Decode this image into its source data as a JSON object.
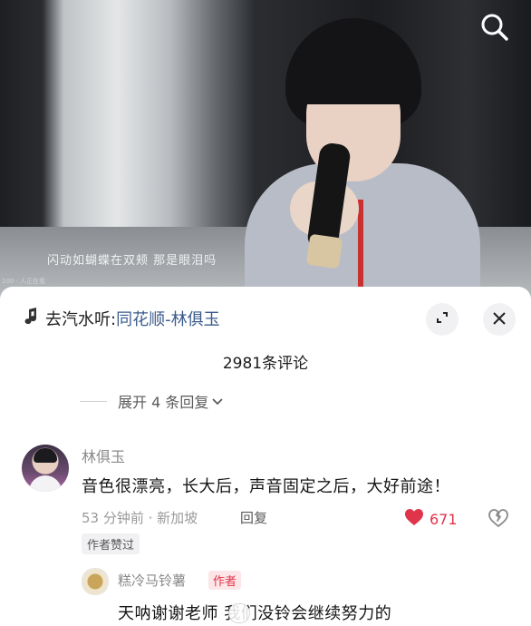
{
  "video": {
    "lyric": "闪动如蝴蝶在双颊 那是眼泪吗",
    "small_watermark": "100 · 人正在看",
    "search_icon": "search-icon"
  },
  "sheet": {
    "music_prefix": "去汽水听:",
    "music_link": "同花顺-林俱玉",
    "comment_count": "2981条评论",
    "expand_replies": "展开 4 条回复",
    "icons": {
      "music": "music-note-icon",
      "minimize": "minimize-icon",
      "close": "close-icon"
    }
  },
  "comment": {
    "author": "林俱玉",
    "text": "音色很漂亮，长大后，声音固定之后，大好前途！",
    "meta": "53 分钟前 · 新加坡",
    "reply_label": "回复",
    "like_count": "671",
    "badge": "作者赞过",
    "accent": "#e0344a"
  },
  "sub_comment": {
    "author": "糕冷马铃薯",
    "author_tag": "作者",
    "text": "天呐谢谢老师 我们没铃会继续努力的"
  }
}
